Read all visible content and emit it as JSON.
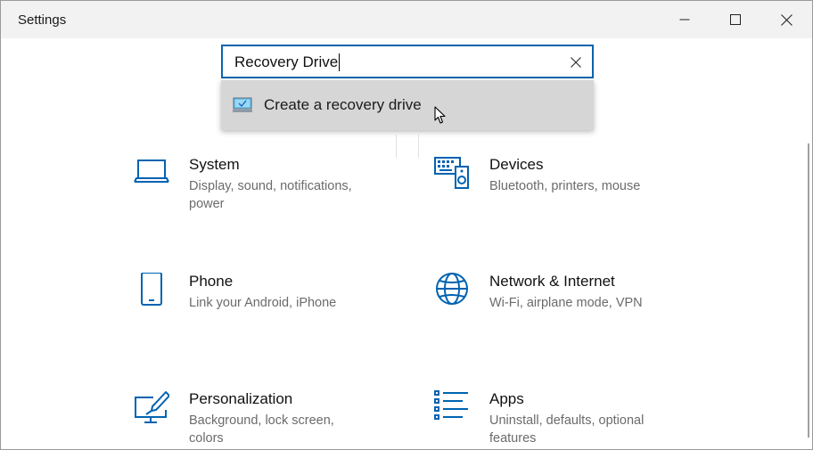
{
  "window": {
    "title": "Settings"
  },
  "search": {
    "value": "Recovery Drive"
  },
  "suggestions": [
    {
      "label": "Create a recovery drive",
      "icon": "recovery-drive-icon"
    }
  ],
  "categories": [
    {
      "title": "System",
      "desc": "Display, sound, notifications, power",
      "icon": "laptop-icon"
    },
    {
      "title": "Devices",
      "desc": "Bluetooth, printers, mouse",
      "icon": "keyboard-speaker-icon"
    },
    {
      "title": "Phone",
      "desc": "Link your Android, iPhone",
      "icon": "phone-icon"
    },
    {
      "title": "Network & Internet",
      "desc": "Wi-Fi, airplane mode, VPN",
      "icon": "globe-icon"
    },
    {
      "title": "Personalization",
      "desc": "Background, lock screen, colors",
      "icon": "paint-brush-icon"
    },
    {
      "title": "Apps",
      "desc": "Uninstall, defaults, optional features",
      "icon": "apps-list-icon"
    }
  ],
  "colors": {
    "accent": "#0a64ad",
    "icon": "#0063b1",
    "dropdown": "#d6d6d6",
    "titlebar": "#f2f2f2"
  }
}
